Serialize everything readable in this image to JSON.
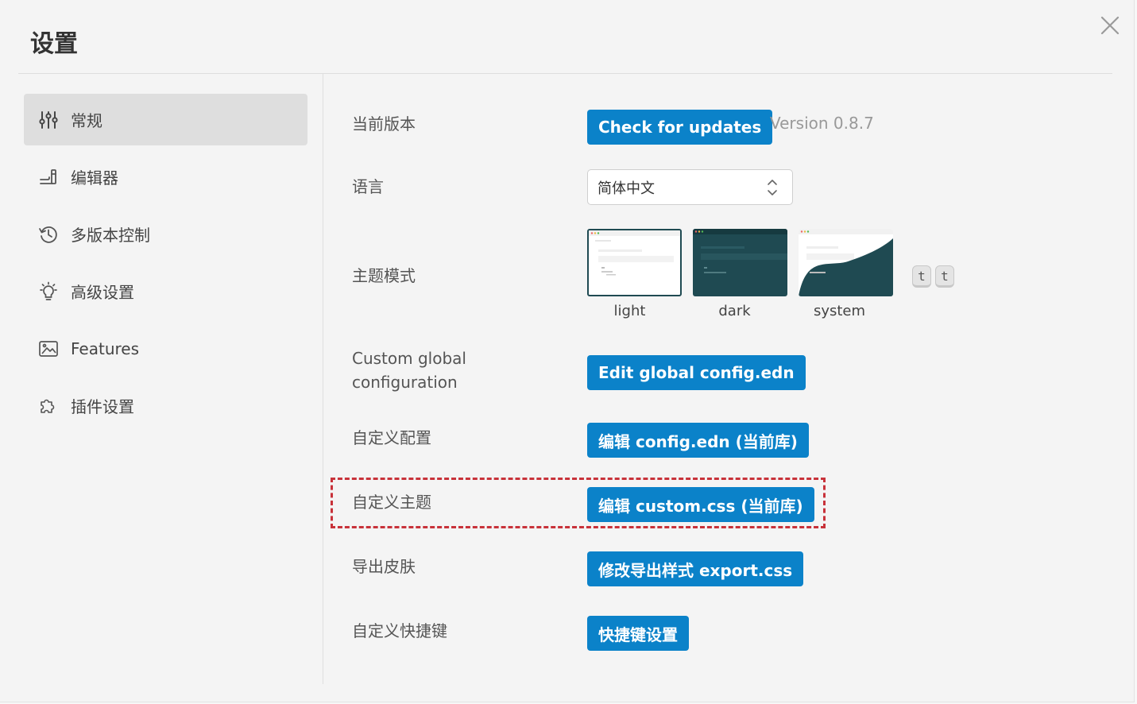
{
  "dialog": {
    "title": "设置"
  },
  "sidebar": {
    "items": [
      {
        "label": "常规",
        "icon": "sliders-icon",
        "active": true
      },
      {
        "label": "编辑器",
        "icon": "editor-icon",
        "active": false
      },
      {
        "label": "多版本控制",
        "icon": "history-icon",
        "active": false
      },
      {
        "label": "高级设置",
        "icon": "lightbulb-icon",
        "active": false
      },
      {
        "label": "Features",
        "icon": "image-icon",
        "active": false
      },
      {
        "label": "插件设置",
        "icon": "puzzle-icon",
        "active": false
      }
    ]
  },
  "settings": {
    "version": {
      "label": "当前版本",
      "button": "Check for updates",
      "value": "Version 0.8.7"
    },
    "language": {
      "label": "语言",
      "selected": "简体中文"
    },
    "theme": {
      "label": "主题模式",
      "options": [
        "light",
        "dark",
        "system"
      ],
      "selected": "light",
      "shortcut_keys": [
        "t",
        "t"
      ]
    },
    "global_config": {
      "label": "Custom global configuration",
      "button": "Edit global config.edn"
    },
    "custom_config": {
      "label": "自定义配置",
      "button": "编辑 config.edn (当前库)"
    },
    "custom_theme": {
      "label": "自定义主题",
      "button": "编辑 custom.css (当前库)"
    },
    "export_skin": {
      "label": "导出皮肤",
      "button": "修改导出样式 export.css"
    },
    "shortcuts": {
      "label": "自定义快捷键",
      "button": "快捷键设置"
    }
  },
  "colors": {
    "accent": "#0b82c9",
    "highlight_border": "#c8323a",
    "active_sidebar_bg": "#dedede",
    "dark_theme": "#1f4a52"
  }
}
